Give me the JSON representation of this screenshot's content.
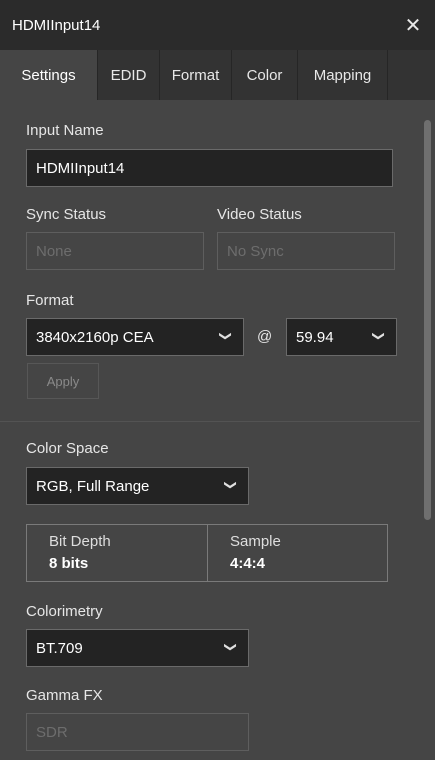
{
  "window": {
    "title": "HDMIInput14",
    "close_glyph": "✕"
  },
  "tabs": [
    {
      "label": "Settings",
      "active": true
    },
    {
      "label": "EDID"
    },
    {
      "label": "Format"
    },
    {
      "label": "Color"
    },
    {
      "label": "Mapping"
    }
  ],
  "settings": {
    "input_name": {
      "label": "Input Name",
      "value": "HDMIInput14"
    },
    "sync_status": {
      "label": "Sync Status",
      "value": "None"
    },
    "video_status": {
      "label": "Video Status",
      "value": "No Sync"
    },
    "format": {
      "label": "Format",
      "resolution": "3840x2160p CEA",
      "at": "@",
      "rate": "59.94",
      "apply_label": "Apply"
    },
    "color_space": {
      "label": "Color Space",
      "value": "RGB, Full Range"
    },
    "bit_depth": {
      "label": "Bit Depth",
      "value": "8 bits"
    },
    "sample": {
      "label": "Sample",
      "value": "4:4:4"
    },
    "colorimetry": {
      "label": "Colorimetry",
      "value": "BT.709"
    },
    "gamma_fx": {
      "label": "Gamma FX",
      "value": "SDR"
    }
  },
  "icons": {
    "chevron": "chevron-down-icon",
    "close": "close-icon"
  },
  "colors": {
    "titlebar": "#2b2b2b",
    "panel": "#454545",
    "field": "#232323"
  }
}
